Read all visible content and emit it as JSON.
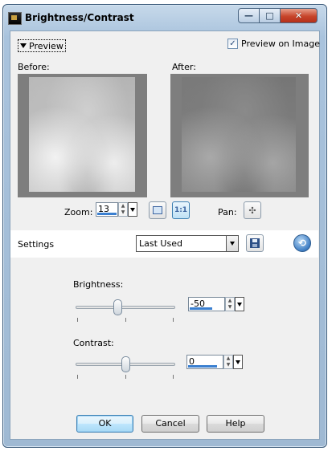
{
  "window": {
    "title": "Brightness/Contrast",
    "controls": {
      "minimize": "—",
      "maximize": "□",
      "close": "✕"
    }
  },
  "preview": {
    "toggle_label": "Preview",
    "preview_on_image_label": "Preview on Image",
    "preview_on_image_checked": true,
    "before_label": "Before:",
    "after_label": "After:"
  },
  "zoom": {
    "label": "Zoom:",
    "value": "13",
    "fill_fraction": 0.13,
    "fit_button_icon": "zoom-to-fit-icon",
    "actual_size_label": "1:1"
  },
  "pan": {
    "label": "Pan:",
    "icon": "pan-move-icon",
    "glyph": "✣"
  },
  "settings": {
    "label": "Settings",
    "preset_value": "Last Used",
    "save_icon": "floppy-disk-icon",
    "reset_icon": "reset-icon"
  },
  "brightness": {
    "label": "Brightness:",
    "value": "-50",
    "fill_fraction": 0.5,
    "slider_level": 0.42
  },
  "contrast": {
    "label": "Contrast:",
    "value": "0",
    "fill_fraction": 0.55,
    "slider_level": 0.5
  },
  "buttons": {
    "ok": "OK",
    "cancel": "Cancel",
    "help": "Help"
  }
}
